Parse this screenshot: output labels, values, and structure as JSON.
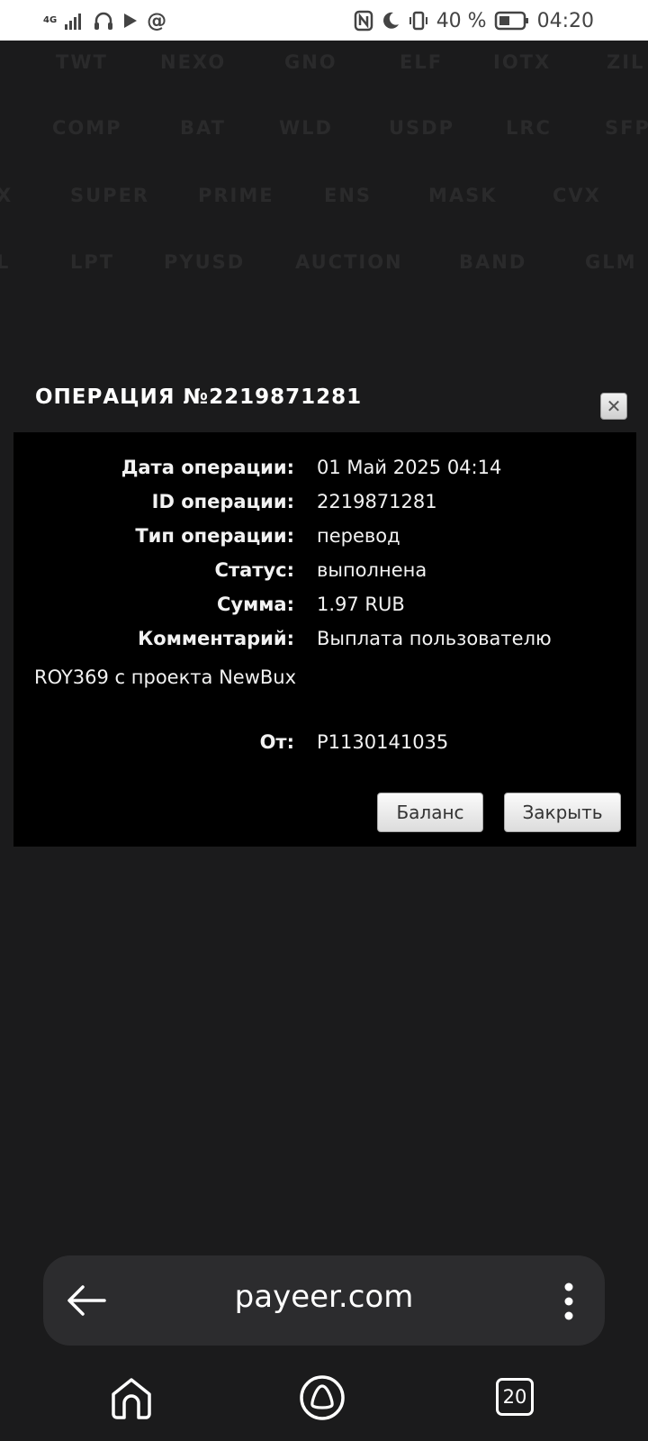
{
  "status_bar": {
    "network": "4G",
    "battery": "40 %",
    "time": "04:20"
  },
  "background_tickers": [
    [
      "TWT",
      "NEXO",
      "GNO",
      "ELF",
      "IOTX",
      "ZIL"
    ],
    [
      "COMP",
      "BAT",
      "WLD",
      "USDP",
      "LRC",
      "SFP"
    ],
    [
      "X",
      "SUPER",
      "PRIME",
      "ENS",
      "MASK",
      "CVX"
    ],
    [
      "L",
      "LPT",
      "PYUSD",
      "AUCTION",
      "BAND",
      "GLM"
    ]
  ],
  "dialog": {
    "title": "ОПЕРАЦИЯ №2219871281",
    "rows": [
      {
        "label": "Дата операции:",
        "value": "01 Май 2025 04:14"
      },
      {
        "label": "ID операции:",
        "value": "2219871281"
      },
      {
        "label": "Тип операции:",
        "value": "перевод"
      },
      {
        "label": "Статус:",
        "value": "выполнена"
      },
      {
        "label": "Сумма:",
        "value": "1.97 RUB"
      },
      {
        "label": "Комментарий:",
        "value": "Выплата пользователю"
      },
      {
        "label": "От:",
        "value": "P1130141035"
      }
    ],
    "comment_continuation": "ROY369 с проекта NewBux",
    "balance_button": "Баланс",
    "close_button": "Закрыть"
  },
  "browser": {
    "url": "payeer.com",
    "tabs_count": "20"
  }
}
